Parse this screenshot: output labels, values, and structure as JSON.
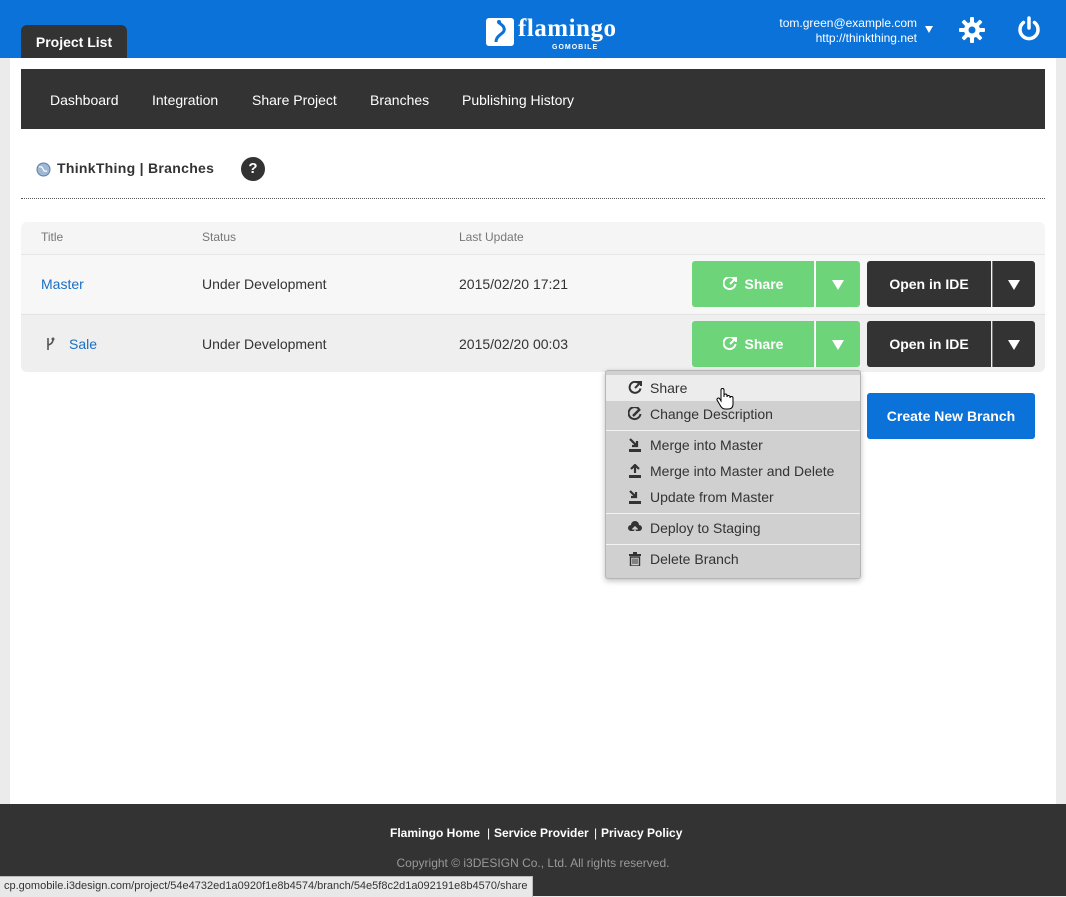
{
  "header": {
    "project_list_tab": "Project List",
    "logo_text": "flamingo",
    "logo_sub": "GOMOBILE",
    "account_email": "tom.green@example.com",
    "account_site": "http://thinkthing.net"
  },
  "subnav": {
    "items": [
      "Dashboard",
      "Integration",
      "Share Project",
      "Branches",
      "Publishing History"
    ]
  },
  "breadcrumb": {
    "text": "ThinkThing | Branches",
    "help": "?"
  },
  "table": {
    "columns": [
      "Title",
      "Status",
      "Last Update"
    ],
    "rows": [
      {
        "title": "Master",
        "status": "Under Development",
        "last_update": "2015/02/20 17:21"
      },
      {
        "title": "Sale",
        "status": "Under Development",
        "last_update": "2015/02/20 00:03"
      }
    ],
    "share_label": "Share",
    "open_ide_label": "Open in IDE"
  },
  "create_branch_label": "Create New Branch",
  "dropdown_menu": {
    "items": [
      {
        "label": "Share",
        "icon": "share-icon"
      },
      {
        "label": "Change Description",
        "icon": "edit-icon"
      },
      {
        "label": "Merge into Master",
        "icon": "merge-icon"
      },
      {
        "label": "Merge into Master and Delete",
        "icon": "merge-delete-icon"
      },
      {
        "label": "Update from Master",
        "icon": "update-icon"
      },
      {
        "label": "Deploy to Staging",
        "icon": "cloud-upload-icon"
      },
      {
        "label": "Delete Branch",
        "icon": "trash-icon"
      }
    ]
  },
  "footer": {
    "links": [
      "Flamingo Home",
      "Service Provider",
      "Privacy Policy"
    ],
    "copyright": "Copyright © i3DESIGN Co., Ltd. All rights reserved."
  },
  "status_bar_url": "cp.gomobile.i3design.com/project/54e4732ed1a0920f1e8b4574/branch/54e5f8c2d1a092191e8b4570/share",
  "colors": {
    "brand_blue": "#0a72d8",
    "share_green": "#6dd47a",
    "dark": "#333333"
  }
}
